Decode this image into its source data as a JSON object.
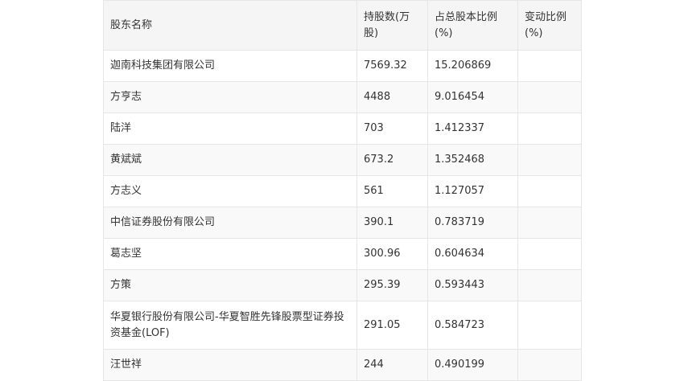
{
  "table": {
    "headers": [
      "股东名称",
      "持股数(万股)",
      "占总股本比例(%)",
      "变动比例(%)"
    ],
    "rows": [
      [
        "迦南科技集团有限公司",
        "7569.32",
        "15.206869",
        ""
      ],
      [
        "方亨志",
        "4488",
        "9.016454",
        ""
      ],
      [
        "陆洋",
        "703",
        "1.412337",
        ""
      ],
      [
        "黄斌斌",
        "673.2",
        "1.352468",
        ""
      ],
      [
        "方志义",
        "561",
        "1.127057",
        ""
      ],
      [
        "中信证券股份有限公司",
        "390.1",
        "0.783719",
        ""
      ],
      [
        "葛志坚",
        "300.96",
        "0.604634",
        ""
      ],
      [
        "方策",
        "295.39",
        "0.593443",
        ""
      ],
      [
        "华夏银行股份有限公司-华夏智胜先锋股票型证券投资基金(LOF)",
        "291.05",
        "0.584723",
        ""
      ],
      [
        "汪世祥",
        "244",
        "0.490199",
        ""
      ]
    ]
  }
}
